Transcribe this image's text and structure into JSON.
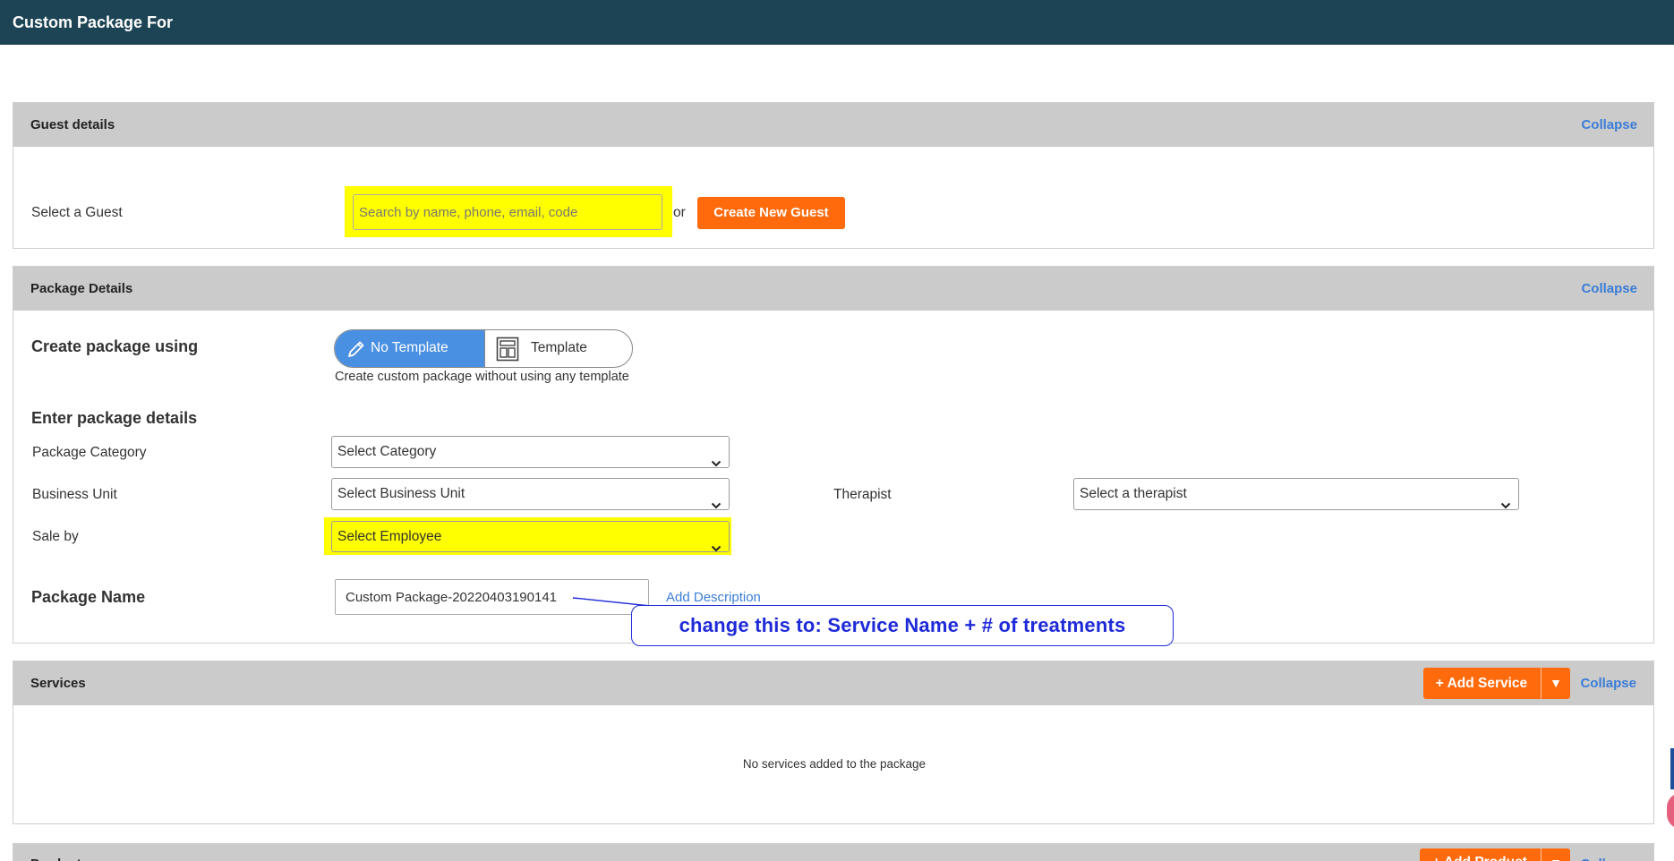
{
  "topbar": {
    "title": "Custom Package For"
  },
  "guest_details": {
    "title": "Guest details",
    "collapse_label": "Collapse",
    "select_guest_label": "Select a Guest",
    "search_placeholder": "Search by name, phone, email, code",
    "or_label": "or",
    "create_guest_label": "Create New Guest"
  },
  "package_details": {
    "title": "Package Details",
    "collapse_label": "Collapse",
    "create_using_label": "Create package using",
    "toggle": {
      "no_template_label": "No Template",
      "template_label": "Template",
      "selected": "No Template"
    },
    "toggle_hint": "Create custom package without using any template",
    "enter_details_label": "Enter package details",
    "category_label": "Package Category",
    "category_value": "Select Category",
    "business_unit_label": "Business Unit",
    "business_unit_value": "Select Business Unit",
    "therapist_label": "Therapist",
    "therapist_value": "Select a therapist",
    "sale_by_label": "Sale by",
    "sale_by_value": "Select Employee",
    "package_name_label": "Package Name",
    "package_name_value": "Custom Package-20220403190141",
    "add_description_label": "Add Description",
    "annotation_text": "change this to: Service Name + # of treatments"
  },
  "services": {
    "title": "Services",
    "add_label": "+ Add Service",
    "collapse_label": "Collapse",
    "empty_text": "No services added to the package"
  },
  "products": {
    "title": "Products",
    "add_label": "+ Add Product",
    "collapse_label": "Collapse"
  },
  "colors": {
    "topbar": "#1d4454",
    "accent_orange": "#ff6a0c",
    "link_blue": "#3b7dd8",
    "toggle_blue": "#4a90e2",
    "highlight": "#ffff00",
    "annotation_blue": "#1f2bd8"
  }
}
